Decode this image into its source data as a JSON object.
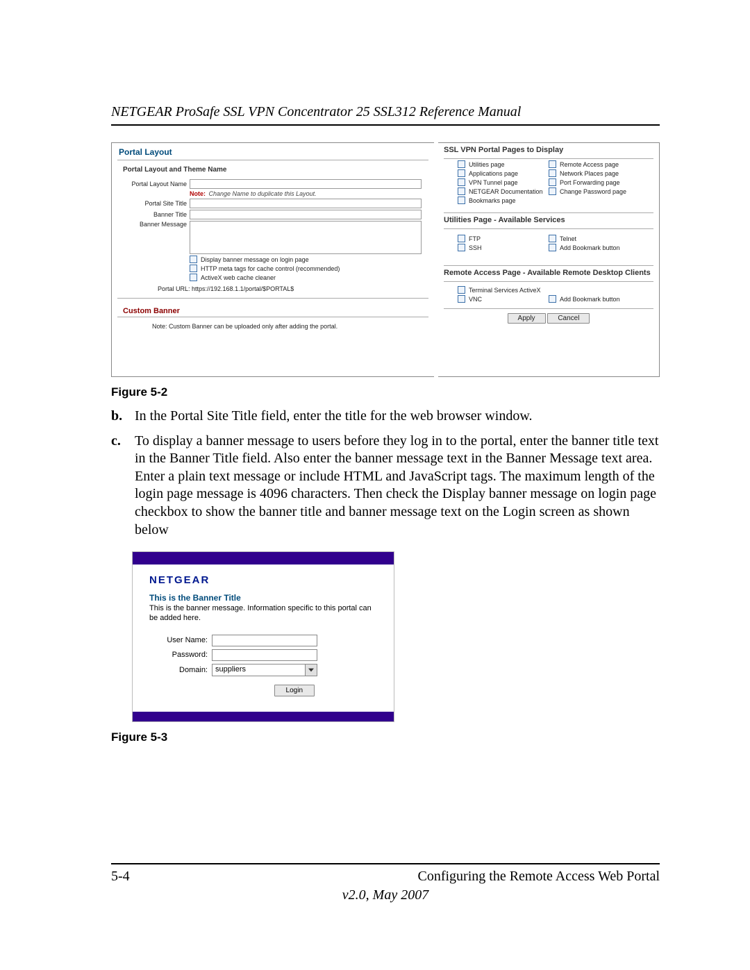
{
  "header": {
    "title": "NETGEAR ProSafe SSL VPN Concentrator 25 SSL312 Reference Manual"
  },
  "fig52": {
    "caption": "Figure 5-2",
    "left": {
      "title": "Portal Layout",
      "subheader": "Portal Layout and Theme Name",
      "labels": {
        "name": "Portal Layout Name",
        "site": "Portal Site Title",
        "banner": "Banner Title",
        "msg": "Banner Message"
      },
      "note_label": "Note:",
      "note_text": " Change Name to duplicate this Layout.",
      "cb1": "Display banner message on login page",
      "cb2": "HTTP meta tags for cache control (recommended)",
      "cb3": "ActiveX web cache cleaner",
      "url": "Portal URL: https://192.168.1.1/portal/$PORTAL$",
      "custom_banner": "Custom Banner",
      "custom_note": "Note: Custom Banner can be uploaded only after adding the portal."
    },
    "right": {
      "sec1": "SSL VPN Portal Pages to Display",
      "col1": [
        "Utilities page",
        "Applications page",
        "VPN Tunnel page",
        "NETGEAR Documentation",
        "Bookmarks page"
      ],
      "col2": [
        "Remote Access page",
        "Network Places page",
        "Port Forwarding page",
        "Change Password page"
      ],
      "sec2": "Utilities Page - Available Services",
      "util_col1": [
        "FTP",
        "SSH"
      ],
      "util_col2": [
        "Telnet",
        "Add Bookmark button"
      ],
      "sec3": "Remote Access Page - Available Remote Desktop Clients",
      "ra_items": [
        "Terminal Services ActiveX",
        "VNC"
      ],
      "ra_right": "Add Bookmark button",
      "apply": "Apply",
      "cancel": "Cancel"
    }
  },
  "body": {
    "b_marker": "b.",
    "b_text": "In the Portal Site Title field, enter the title for the web browser window.",
    "c_marker": "c.",
    "c_text": "To display a banner message to users before they log in to the portal, enter the banner title text in the Banner Title field. Also enter the banner message text in the Banner Message text area. Enter a plain text message or include HTML and JavaScript tags. The maximum length of the login page message is 4096 characters. Then check the Display banner message on login page checkbox to show the banner title and banner message text on the Login screen as shown below"
  },
  "fig53": {
    "caption": "Figure 5-3",
    "logo": "NETGEAR",
    "banner_title": "This is the Banner Title",
    "banner_msg": "This is the banner message. Information specific to this portal can be added here.",
    "user_label": "User Name:",
    "pass_label": "Password:",
    "domain_label": "Domain:",
    "domain_value": "suppliers",
    "login_btn": "Login"
  },
  "footer": {
    "page": "5-4",
    "section": "Configuring the Remote Access Web Portal",
    "version": "v2.0, May 2007"
  }
}
